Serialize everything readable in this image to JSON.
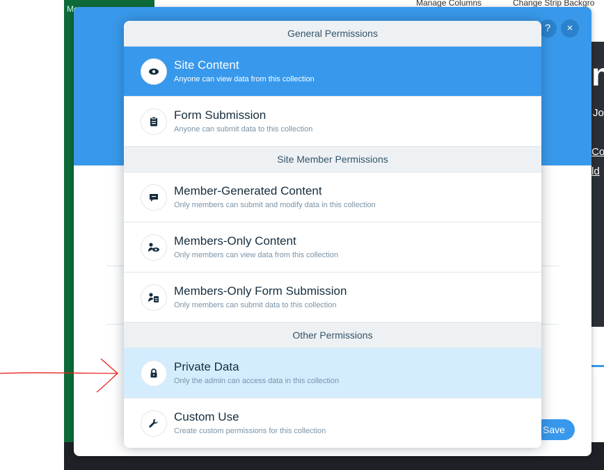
{
  "background": {
    "left_strip_label": "Mo",
    "toolbar": {
      "manage_columns": "Manage Columns",
      "change_strip": "Change Strip Backgro"
    },
    "right_fragments": [
      "nt",
      "Jo",
      "Co",
      "ld"
    ]
  },
  "dialog": {
    "help_glyph": "?",
    "close_glyph": "×",
    "save_label": "Save"
  },
  "permissions": {
    "sections": [
      {
        "header": "General Permissions",
        "items": [
          {
            "icon": "eye-icon",
            "title": "Site Content",
            "desc": "Anyone can view data from this collection",
            "state": "selected"
          },
          {
            "icon": "clipboard-icon",
            "title": "Form Submission",
            "desc": "Anyone can submit data to this collection",
            "state": "normal"
          }
        ]
      },
      {
        "header": "Site Member Permissions",
        "items": [
          {
            "icon": "chat-bubble-icon",
            "title": "Member-Generated Content",
            "desc": "Only members can submit and modify data in this collection",
            "state": "normal"
          },
          {
            "icon": "member-eye-icon",
            "title": "Members-Only Content",
            "desc": "Only members can view data from this collection",
            "state": "normal"
          },
          {
            "icon": "member-clipboard-icon",
            "title": "Members-Only Form Submission",
            "desc": "Only members can submit data to this collection",
            "state": "normal"
          }
        ]
      },
      {
        "header": "Other Permissions",
        "items": [
          {
            "icon": "lock-icon",
            "title": "Private Data",
            "desc": "Only the admin can access data in this collection",
            "state": "hover"
          },
          {
            "icon": "wrench-icon",
            "title": "Custom Use",
            "desc": "Create custom permissions for this collection",
            "state": "normal"
          }
        ]
      }
    ]
  },
  "colors": {
    "accent": "#3899ec",
    "hover": "#d3edff",
    "annotation_arrow": "#e8231c"
  }
}
